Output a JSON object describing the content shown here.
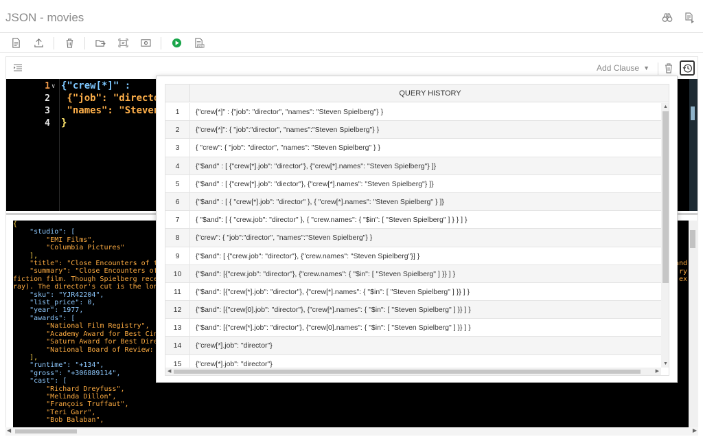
{
  "window": {
    "title": "JSON - movies"
  },
  "title_icons": [
    "binoculars-icon",
    "document-play-icon"
  ],
  "toolbar": {
    "buttons": [
      "new-document-icon",
      "upload-icon",
      "delete-icon",
      "open-folder-icon",
      "screenshot-icon",
      "preview-icon",
      "run-icon",
      "sql-icon"
    ],
    "colors": {
      "run": "#1aa64b"
    }
  },
  "panel": {
    "add_clause": "Add Clause"
  },
  "query_editor": {
    "lines": [
      {
        "num": "1",
        "text": "{\"crew[*]\" :"
      },
      {
        "num": "2",
        "text": " {\"job\": \"director"
      },
      {
        "num": "3",
        "text": " \"names\": \"Steven"
      },
      {
        "num": "4",
        "text": "}"
      }
    ]
  },
  "result_document": {
    "lines": [
      "{",
      "    \"studio\": [",
      "        \"EMI Films\",",
      "        \"Columbia Pictures\"",
      "    ],",
      "    \"title\": \"Close Encounters of th",
      "    \"summary\": \"Close Encounters of",
      "fiction film. Though Spielberg rece",
      "ray). The director's cut is the lon",
      "    \"sku\": \"YJR42204\",",
      "    \"list_price\": 0,",
      "    \"year\": 1977,",
      "    \"awards\": [",
      "        \"National Film Registry\",",
      "        \"Academy Award for Best Cin",
      "        \"Saturn Award for Best Dire",
      "        \"National Board of Review: ",
      "    ],",
      "    \"runtime\": \"+134\",",
      "    \"gross\": \"+306889114\",",
      "    \"cast\": [",
      "        \"Richard Dreyfuss\",",
      "        \"Melinda Dillon\",",
      "        \"François Truffaut\",",
      "        \"Teri Garr\",",
      "        \"Bob Balaban\","
    ],
    "right_edge_fragments": [
      "and",
      "ry",
      "ex"
    ]
  },
  "query_history": {
    "title": "QUERY HISTORY",
    "rows": [
      {
        "num": "1",
        "query": "{\"crew[*]\" : {\"job\": \"director\", \"names\": \"Steven Spielberg\"} }"
      },
      {
        "num": "2",
        "query": "{\"crew[*]\": { \"job\":\"director\", \"names\":\"Steven Spielberg\"} }"
      },
      {
        "num": "3",
        "query": "{ \"crew\": { \"job\": \"director\", \"names\": \"Steven Spielberg\" } }"
      },
      {
        "num": "4",
        "query": "{\"$and\" : [ {\"crew[*].job\": \"director\"}, {\"crew[*].names\": \"Steven Spielberg\"} ]}"
      },
      {
        "num": "5",
        "query": "{\"$and\" : [ {\"crew[*].job\": \"diector\"}, {\"crew[*].names\": \"Steven Spielberg\"} ]}"
      },
      {
        "num": "6",
        "query": "{\"$and\" : [ { \"crew[*].job\": \"director\" }, { \"crew[*].names\": \"Steven Spielberg\" } ]}"
      },
      {
        "num": "7",
        "query": "{ \"$and\": [ { \"crew.job\": \"director\" }, { \"crew.names\": { \"$in\": [ \"Steven Spielberg\" ] } } ] }"
      },
      {
        "num": "8",
        "query": "{\"crew\": { \"job\":\"director\", \"names\":\"Steven Spielberg\"} }"
      },
      {
        "num": "9",
        "query": "{\"$and\": [ {\"crew.job\": \"director\"}, {\"crew.names\": \"Steven Spielberg\"}] }"
      },
      {
        "num": "10",
        "query": "{\"$and\": [{\"crew.job\": \"director\"}, {\"crew.names\": { \"$in\": [ \"Steven Spielberg\" ] }} ] }"
      },
      {
        "num": "11",
        "query": "{\"$and\": [{\"crew[*].job\": \"director\"}, {\"crew[*].names\": { \"$in\": [ \"Steven Spielberg\" ] }} ] }"
      },
      {
        "num": "12",
        "query": "{\"$and\": [{\"crew[0].job\": \"director\"}, {\"crew[*].names\": { \"$in\": [ \"Steven Spielberg\" ] }} ] }"
      },
      {
        "num": "13",
        "query": "{\"$and\": [{\"crew[*].job\": \"director\"}, {\"crew[0].names\": { \"$in\": [ \"Steven Spielberg\" ] }} ] }"
      },
      {
        "num": "14",
        "query": "{\"crew[*].job\": \"director\"}"
      },
      {
        "num": "15",
        "query": "{\"crew[*].job\": \"director\"}"
      }
    ]
  }
}
